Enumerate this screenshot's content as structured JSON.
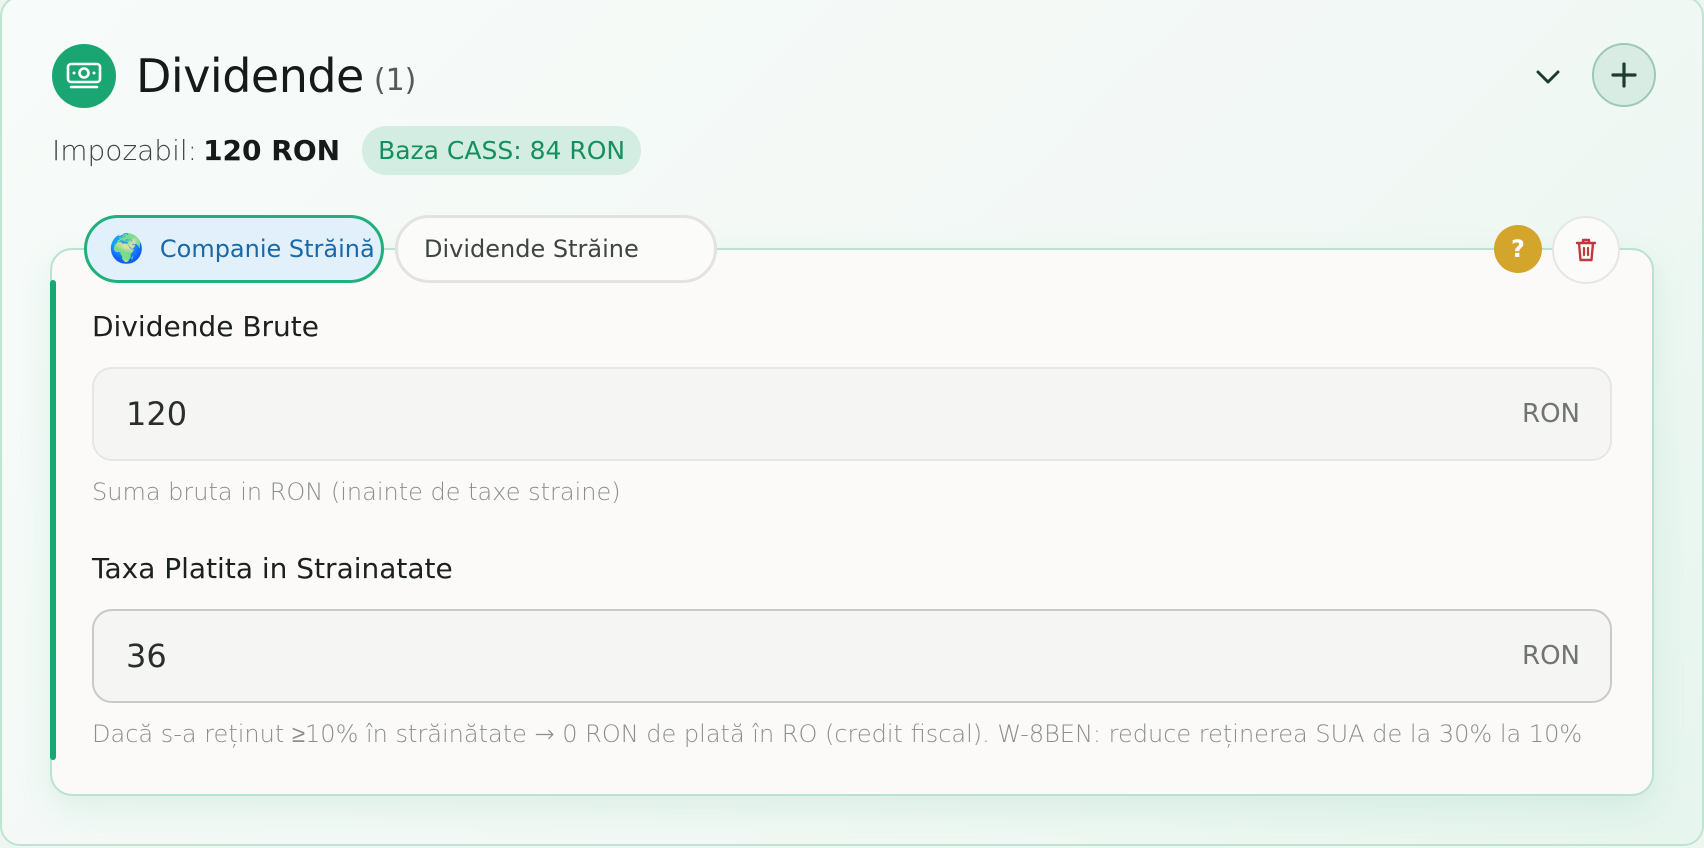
{
  "section": {
    "title": "Dividende",
    "count": "(1)",
    "icon": "money-icon",
    "summary": {
      "taxable_label": "Impozabil:",
      "taxable_value": "120 RON",
      "cass_badge": "Baza CASS: 84 RON"
    }
  },
  "entry": {
    "source_tab": {
      "emoji": "🌍",
      "label": "Companie Străină"
    },
    "type_tab": {
      "label": "Dividende Străine"
    },
    "help_label": "?",
    "gross": {
      "label": "Dividende Brute",
      "value": "120",
      "unit": "RON",
      "hint": "Suma bruta in RON (inainte de taxe straine)"
    },
    "foreign_tax": {
      "label": "Taxa Platita in Strainatate",
      "value": "36",
      "unit": "RON",
      "hint": "Dacă s-a reținut ≥10% în străinătate → 0 RON de plată în RO (credit fiscal). W-8BEN: reduce reținerea SUA de la 30% la 10%"
    }
  },
  "colors": {
    "accent_green": "#1aa673",
    "cass_text": "#14905f",
    "tab_blue": "#1869a8",
    "help_gold": "#d4a52b",
    "delete_red": "#c0393b"
  }
}
